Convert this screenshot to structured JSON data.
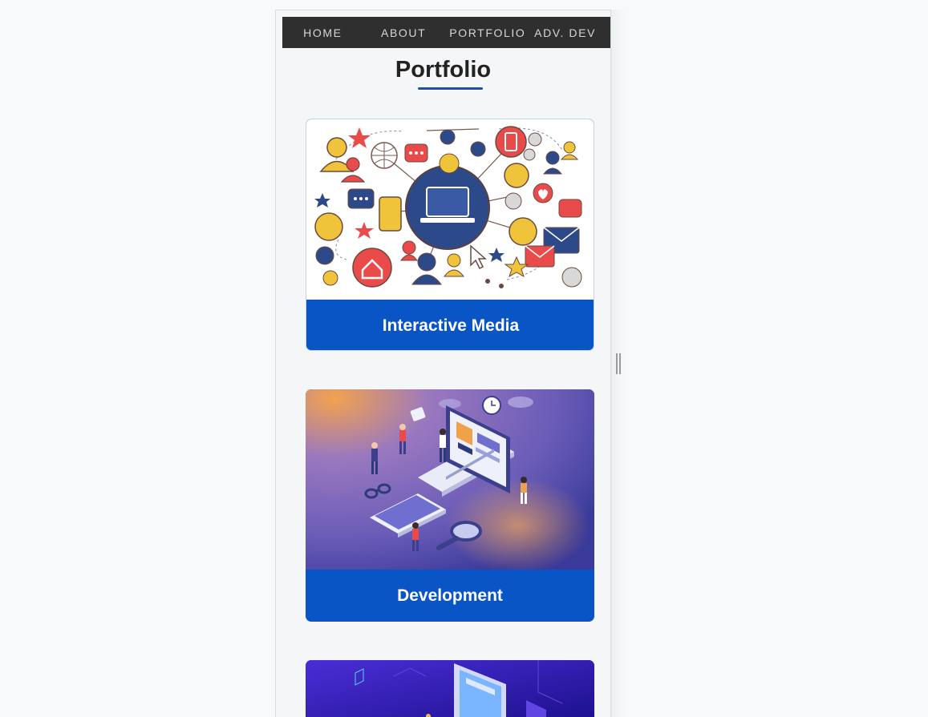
{
  "nav": {
    "items": [
      {
        "label": "HOME"
      },
      {
        "label": "ABOUT"
      },
      {
        "label": "PORTFOLIO"
      },
      {
        "label": "ADV. DEV"
      }
    ]
  },
  "page": {
    "title": "Portfolio"
  },
  "cards": [
    {
      "label": "Interactive Media",
      "image_icon": "social-network-illustration"
    },
    {
      "label": "Development",
      "image_icon": "isometric-development-illustration"
    },
    {
      "label": "",
      "image_icon": "isometric-ui-illustration"
    }
  ],
  "colors": {
    "navbar": "#2f2f2f",
    "card_label_bg": "#0a55c6",
    "accent_underline": "#1d4fa3",
    "page_bg": "#f5f6f7"
  }
}
